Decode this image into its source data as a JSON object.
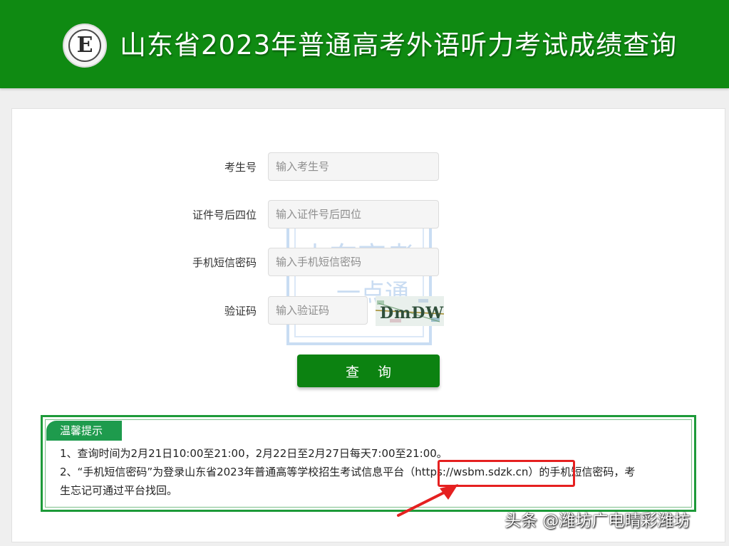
{
  "header": {
    "title": "山东省2023年普通高考外语听力考试成绩查询",
    "logo_letter": "E"
  },
  "form": {
    "fields": [
      {
        "label": "考生号",
        "placeholder": "输入考生号"
      },
      {
        "label": "证件号后四位",
        "placeholder": "输入证件号后四位"
      },
      {
        "label": "手机短信密码",
        "placeholder": "输入手机短信密码"
      },
      {
        "label": "验证码",
        "placeholder": "输入验证码"
      }
    ],
    "captcha_text": "DmDWY",
    "submit_label": "查 询"
  },
  "watermark": {
    "line1": "山东高考",
    "line2": "一点通"
  },
  "notice": {
    "title": "温馨提示",
    "line1": "1、查询时间为2月21日10:00至21:00，2月22日至2月27日每天7:00至21:00。",
    "line2": "2、“手机短信密码”为登录山东省2023年普通高等学校招生考试信息平台（https://wsbm.sdzk.cn）的手机短信密码，考",
    "line3": "生忘记可通过平台找回。"
  },
  "corner_watermark": "头条 @潍坊广电晴彩潍坊",
  "colors": {
    "header_bg": "#0f8a12",
    "button_bg": "#0c8211",
    "notice_border": "#1d9a39",
    "highlight_red": "#e52020"
  }
}
